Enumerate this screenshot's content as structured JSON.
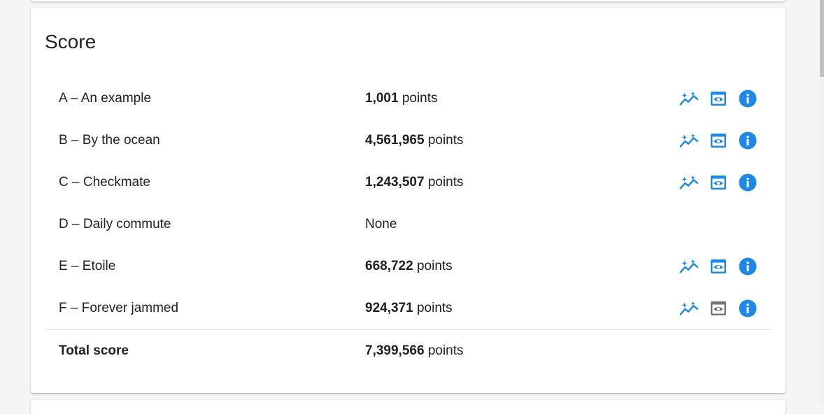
{
  "score_card": {
    "title": "Score",
    "rows": [
      {
        "name": "A – An example",
        "score": "1,001",
        "unit": "points",
        "has_actions": true,
        "view_enabled": true
      },
      {
        "name": "B – By the ocean",
        "score": "4,561,965",
        "unit": "points",
        "has_actions": true,
        "view_enabled": true
      },
      {
        "name": "C – Checkmate",
        "score": "1,243,507",
        "unit": "points",
        "has_actions": true,
        "view_enabled": true
      },
      {
        "name": "D – Daily commute",
        "score": "",
        "unit": "None",
        "has_actions": false,
        "view_enabled": false
      },
      {
        "name": "E – Etoile",
        "score": "668,722",
        "unit": "points",
        "has_actions": true,
        "view_enabled": true
      },
      {
        "name": "F – Forever jammed",
        "score": "924,371",
        "unit": "points",
        "has_actions": true,
        "view_enabled": false
      }
    ],
    "total": {
      "label": "Total score",
      "score": "7,399,566",
      "unit": "points"
    }
  },
  "colors": {
    "accent": "#1e88e5",
    "disabled_icon": "#757575"
  },
  "icons": {
    "chart": "auto-graph-icon",
    "view": "preview-icon",
    "info": "info-icon"
  }
}
